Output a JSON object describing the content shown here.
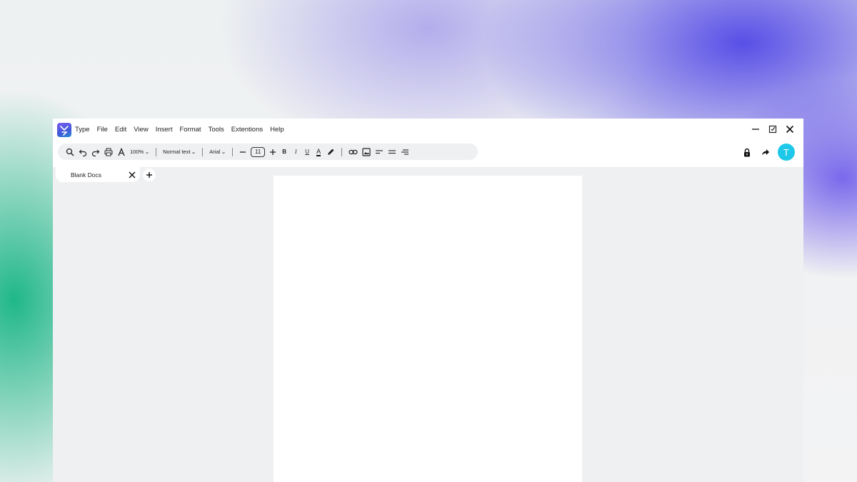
{
  "menu": {
    "items": [
      "Type",
      "File",
      "Edit",
      "View",
      "Insert",
      "Format",
      "Tools",
      "Extentions",
      "Help"
    ]
  },
  "toolbar": {
    "zoom": "100%",
    "paragraph_style": "Normal text",
    "font_family": "Arial",
    "font_size": "11",
    "bold_label": "B",
    "italic_label": "I",
    "underline_label": "U",
    "text_color_label": "A"
  },
  "icons": {
    "app_logo": "app-logo-icon",
    "search": "search-icon",
    "undo": "undo-icon",
    "redo": "redo-icon",
    "print": "print-icon",
    "spellcheck": "spellcheck-icon",
    "highlight": "pen-icon",
    "link": "link-icon",
    "image": "image-icon",
    "align_left": "align-left-icon",
    "align_center": "align-center-icon",
    "align_right": "align-right-icon",
    "lock": "lock-icon",
    "share": "share-arrow-icon",
    "minimize": "minimize-icon",
    "maximize": "maximize-icon",
    "close": "close-icon"
  },
  "user": {
    "avatar_initial": "T",
    "avatar_color": "#1ec8e8"
  },
  "tabs": [
    {
      "label": "Blank Docs"
    }
  ],
  "colors": {
    "accent": "#1ec8e8",
    "canvas_bg": "#eef0f2",
    "page_bg": "#ffffff"
  }
}
